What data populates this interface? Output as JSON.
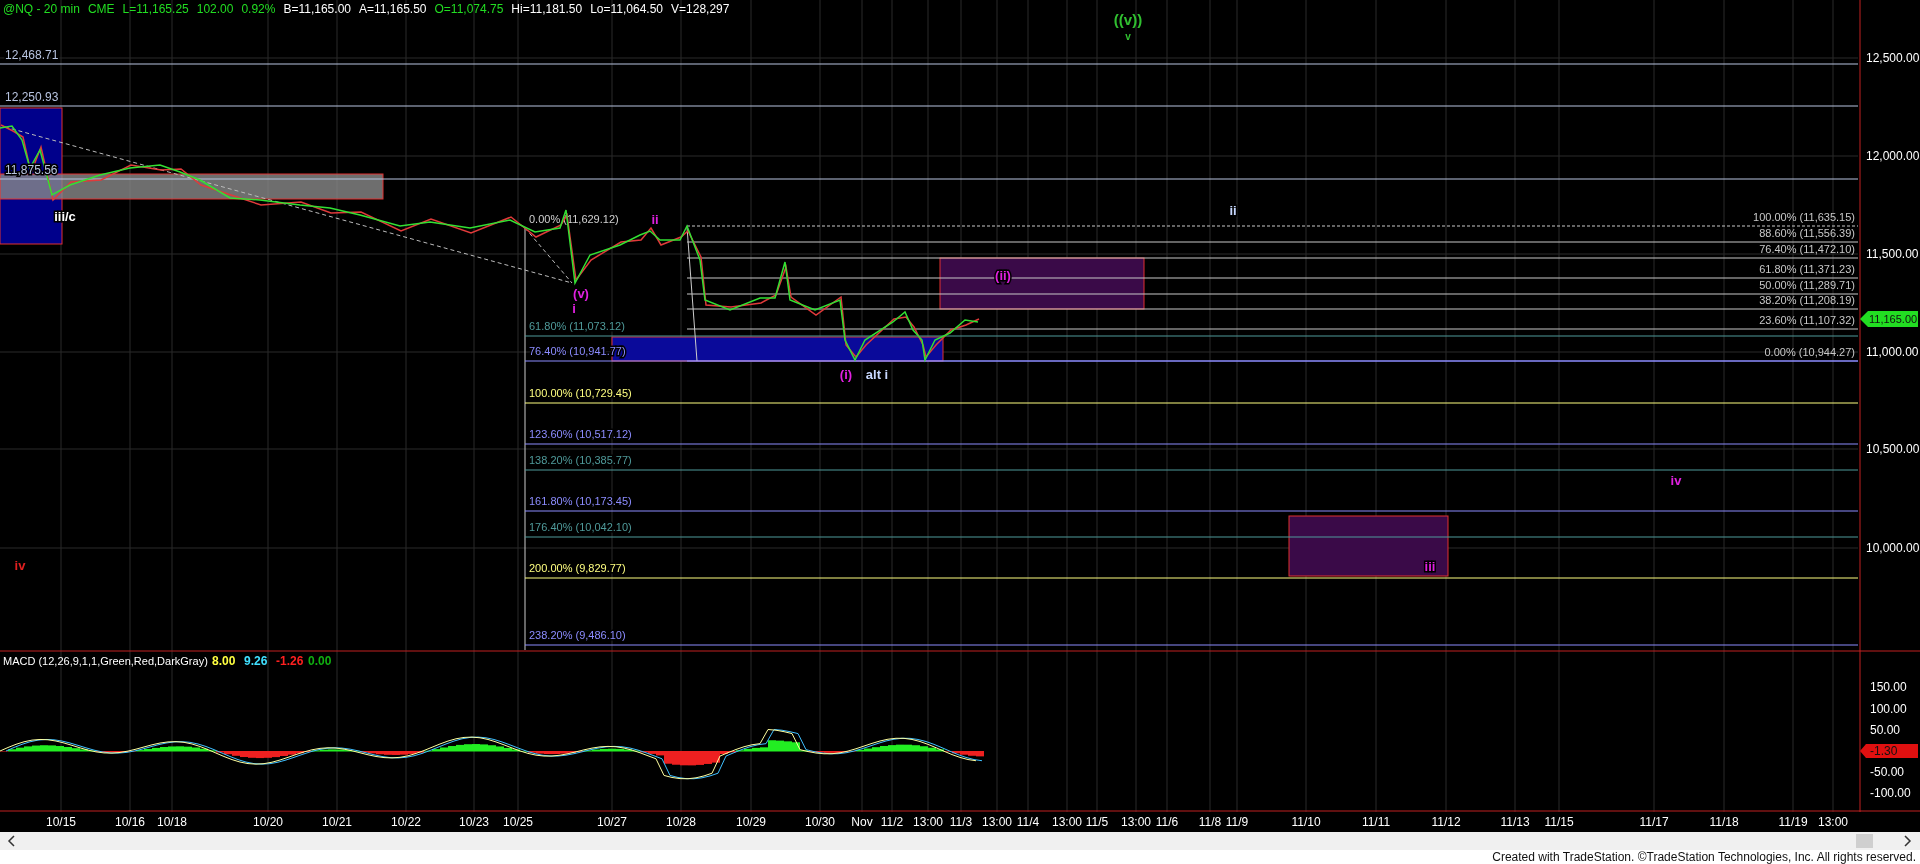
{
  "quote_bar": [
    {
      "text": "@NQ - 20 min",
      "color": "#22dd22"
    },
    {
      "text": "CME",
      "color": "#22dd22"
    },
    {
      "text": "L=11,165.25",
      "color": "#22dd22"
    },
    {
      "text": "102.00",
      "color": "#22dd22"
    },
    {
      "text": "0.92%",
      "color": "#22dd22"
    },
    {
      "text": "B=11,165.00",
      "color": "#ffffff"
    },
    {
      "text": "A=11,165.50",
      "color": "#ffffff"
    },
    {
      "text": "O=11,074.75",
      "color": "#22dd22"
    },
    {
      "text": "Hi=11,181.50",
      "color": "#ffffff"
    },
    {
      "text": "Lo=11,064.50",
      "color": "#ffffff"
    },
    {
      "text": "V=128,297",
      "color": "#ffffff"
    }
  ],
  "wave_title": {
    "degree": "((v))",
    "wave": "v"
  },
  "levels": [
    {
      "label": "12,468.71"
    },
    {
      "label": "12,250.93"
    },
    {
      "label": "11,875.56"
    }
  ],
  "fib_extension": [
    {
      "label": "0.00% (11,629.12)",
      "color": "#d0d0d0"
    },
    {
      "label": "61.80% (11,073.12)",
      "color": "#4f9a9a"
    },
    {
      "label": "76.40% (10,941.77)",
      "color": "#8c8cff"
    },
    {
      "label": "100.00% (10,729.45)",
      "color": "#ffff80"
    },
    {
      "label": "123.60% (10,517.12)",
      "color": "#8c8cff"
    },
    {
      "label": "138.20% (10,385.77)",
      "color": "#4f9a9a"
    },
    {
      "label": "161.80% (10,173.45)",
      "color": "#8c8cff"
    },
    {
      "label": "176.40% (10,042.10)",
      "color": "#4f9a9a"
    },
    {
      "label": "200.00% (9,829.77)",
      "color": "#ffff80"
    },
    {
      "label": "238.20% (9,486.10)",
      "color": "#8c8cff"
    }
  ],
  "fib_retracement": [
    {
      "label": "100.00% (11,635.15)"
    },
    {
      "label": "88.60% (11,556.39)"
    },
    {
      "label": "76.40% (11,472.10)"
    },
    {
      "label": "61.80% (11,371.23)"
    },
    {
      "label": "50.00% (11,289.71)"
    },
    {
      "label": "38.20% (11,208.19)"
    },
    {
      "label": "23.60% (11,107.32)"
    },
    {
      "label": "0.00% (10,944.27)"
    }
  ],
  "wave_labels": [
    {
      "text": "iii/c",
      "color": "#ffffff"
    },
    {
      "text": "ii",
      "color": "#e020e0"
    },
    {
      "text": "(v)",
      "color": "#e020e0"
    },
    {
      "text": "i",
      "color": "#e020e0"
    },
    {
      "text": "(i)",
      "color": "#e020e0"
    },
    {
      "text": "alt i",
      "color": "#c8d8ff"
    },
    {
      "text": "(ii)",
      "color": "#e020e0"
    },
    {
      "text": "ii",
      "color": "#c8d8ff"
    },
    {
      "text": "iii",
      "color": "#e020e0"
    },
    {
      "text": "iv",
      "color": "#e020e0"
    },
    {
      "text": "iv",
      "color": "#e02020"
    }
  ],
  "price_axis": [
    "12,500.00",
    "12,000.00",
    "11,500.00",
    "11,000.00",
    "10,500.00",
    "10,000.00"
  ],
  "last_price": "11,165.00",
  "macd": {
    "title": "MACD (12,26,9,1,1,Green,Red,DarkGray)",
    "values": [
      {
        "text": "8.00",
        "color": "#ffff40"
      },
      {
        "text": "9.26",
        "color": "#40e0ff"
      },
      {
        "text": "-1.26",
        "color": "#ff2020"
      },
      {
        "text": "0.00",
        "color": "#10b010"
      }
    ],
    "axis": [
      "150.00",
      "100.00",
      "50.00",
      "-50.00",
      "-100.00"
    ],
    "last_value": "-1.30"
  },
  "date_axis": [
    "10/15",
    "10/16",
    "10/18",
    "10/20",
    "10/21",
    "10/22",
    "10/23",
    "10/25",
    "10/27",
    "10/28",
    "10/29",
    "10/30",
    "Nov",
    "11/2",
    "13:00",
    "11/3",
    "13:00",
    "11/4",
    "13:00",
    "11/5",
    "13:00",
    "11/6",
    "11/8",
    "11/9",
    "11/10",
    "11/11",
    "11/12",
    "11/13",
    "11/15",
    "11/17",
    "11/18",
    "11/19",
    "13:00"
  ],
  "footer": "Created with TradeStation. ©TradeStation Technologies, Inc. All rights reserved."
}
